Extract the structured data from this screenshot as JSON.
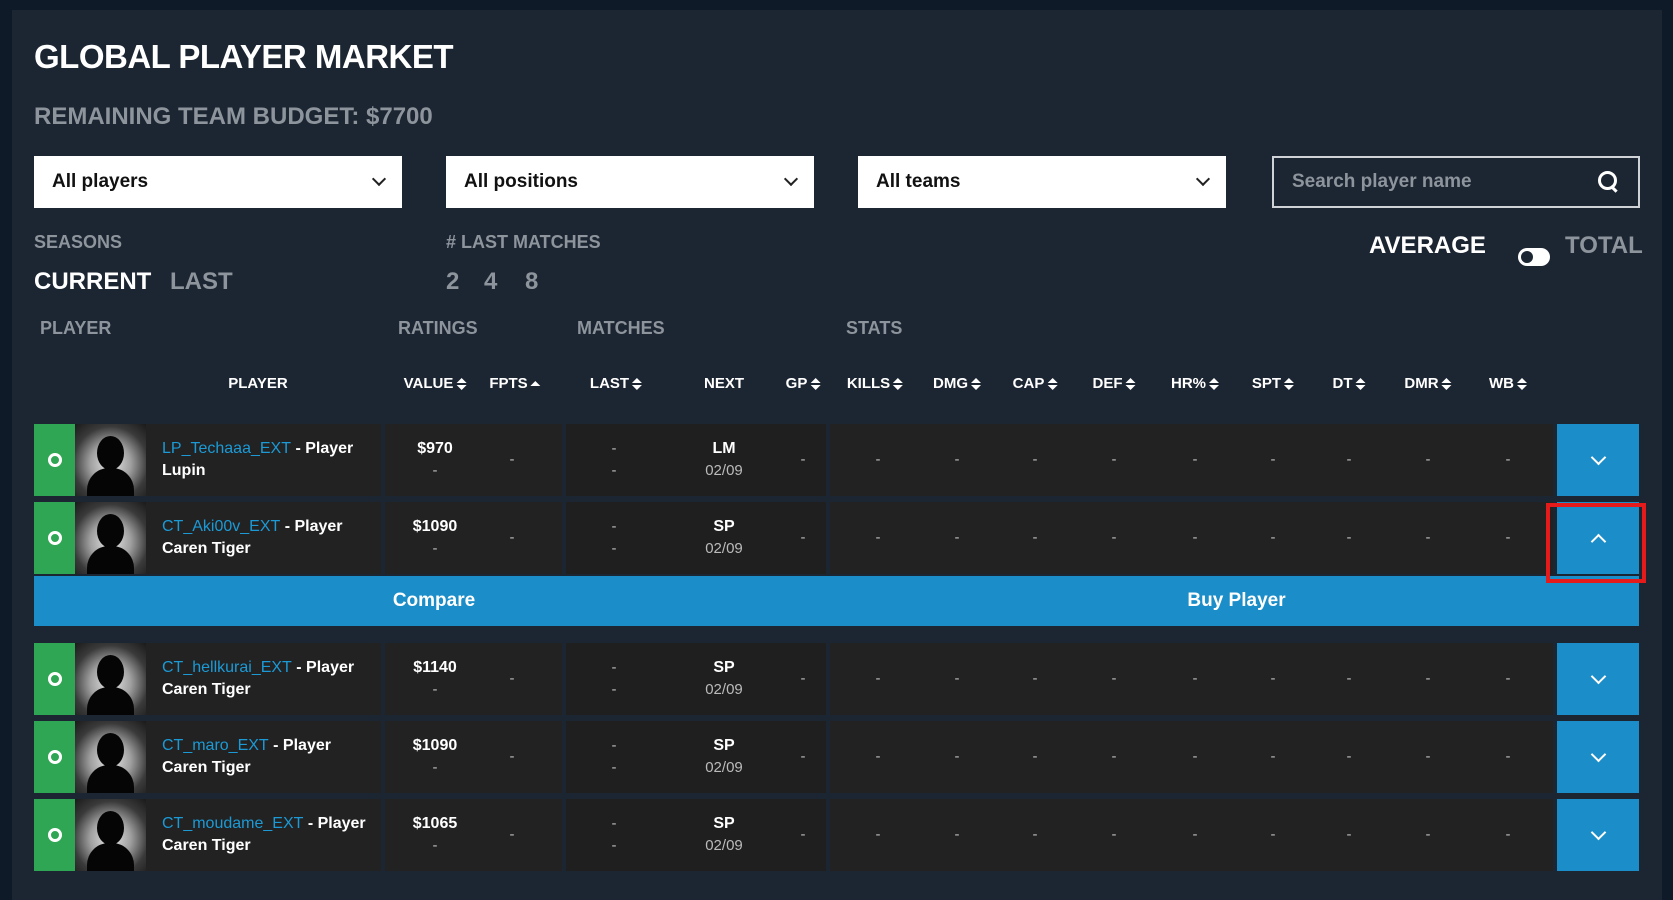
{
  "header": {
    "title": "GLOBAL PLAYER MARKET",
    "budget": "REMAINING TEAM BUDGET: $7700"
  },
  "filters": {
    "players": "All players",
    "positions": "All positions",
    "teams": "All teams",
    "search_placeholder": "Search player name"
  },
  "seasons": {
    "label": "SEASONS",
    "current": "CURRENT",
    "last": "LAST"
  },
  "last_matches": {
    "label": "# LAST MATCHES",
    "options": [
      "2",
      "4",
      "8"
    ]
  },
  "mode": {
    "average": "AVERAGE",
    "total": "TOTAL"
  },
  "groups": {
    "player": "PLAYER",
    "ratings": "RATINGS",
    "matches": "MATCHES",
    "stats": "STATS"
  },
  "columns": [
    "PLAYER",
    "VALUE",
    "FPTS",
    "LAST",
    "NEXT",
    "GP",
    "KILLS",
    "DMG",
    "CAP",
    "DEF",
    "HR%",
    "SPT",
    "DT",
    "DMR",
    "WB"
  ],
  "rows": [
    {
      "name": "LP_Techaaa_EXT",
      "role": "- Player",
      "team": "Lupin",
      "value": "$970",
      "value_sub": "-",
      "fpts": "-",
      "last1": "-",
      "last2": "-",
      "next": "LM",
      "next_date": "02/09",
      "gp": "-",
      "stats": [
        "-",
        "-",
        "-",
        "-",
        "-",
        "-",
        "-",
        "-",
        "-"
      ]
    },
    {
      "name": "CT_Aki00v_EXT",
      "role": "- Player",
      "team": "Caren Tiger",
      "value": "$1090",
      "value_sub": "-",
      "fpts": "-",
      "last1": "-",
      "last2": "-",
      "next": "SP",
      "next_date": "02/09",
      "gp": "-",
      "stats": [
        "-",
        "-",
        "-",
        "-",
        "-",
        "-",
        "-",
        "-",
        "-"
      ]
    },
    {
      "name": "CT_hellkurai_EXT",
      "role": "- Player",
      "team": "Caren Tiger",
      "value": "$1140",
      "value_sub": "-",
      "fpts": "-",
      "last1": "-",
      "last2": "-",
      "next": "SP",
      "next_date": "02/09",
      "gp": "-",
      "stats": [
        "-",
        "-",
        "-",
        "-",
        "-",
        "-",
        "-",
        "-",
        "-"
      ]
    },
    {
      "name": "CT_maro_EXT",
      "role": "- Player",
      "team": "Caren Tiger",
      "value": "$1090",
      "value_sub": "-",
      "fpts": "-",
      "last1": "-",
      "last2": "-",
      "next": "SP",
      "next_date": "02/09",
      "gp": "-",
      "stats": [
        "-",
        "-",
        "-",
        "-",
        "-",
        "-",
        "-",
        "-",
        "-"
      ]
    },
    {
      "name": "CT_moudame_EXT",
      "role": "- Player",
      "team": "Caren Tiger",
      "value": "$1065",
      "value_sub": "-",
      "fpts": "-",
      "last1": "-",
      "last2": "-",
      "next": "SP",
      "next_date": "02/09",
      "gp": "-",
      "stats": [
        "-",
        "-",
        "-",
        "-",
        "-",
        "-",
        "-",
        "-",
        "-"
      ]
    }
  ],
  "actions": {
    "compare": "Compare",
    "buy": "Buy Player"
  }
}
